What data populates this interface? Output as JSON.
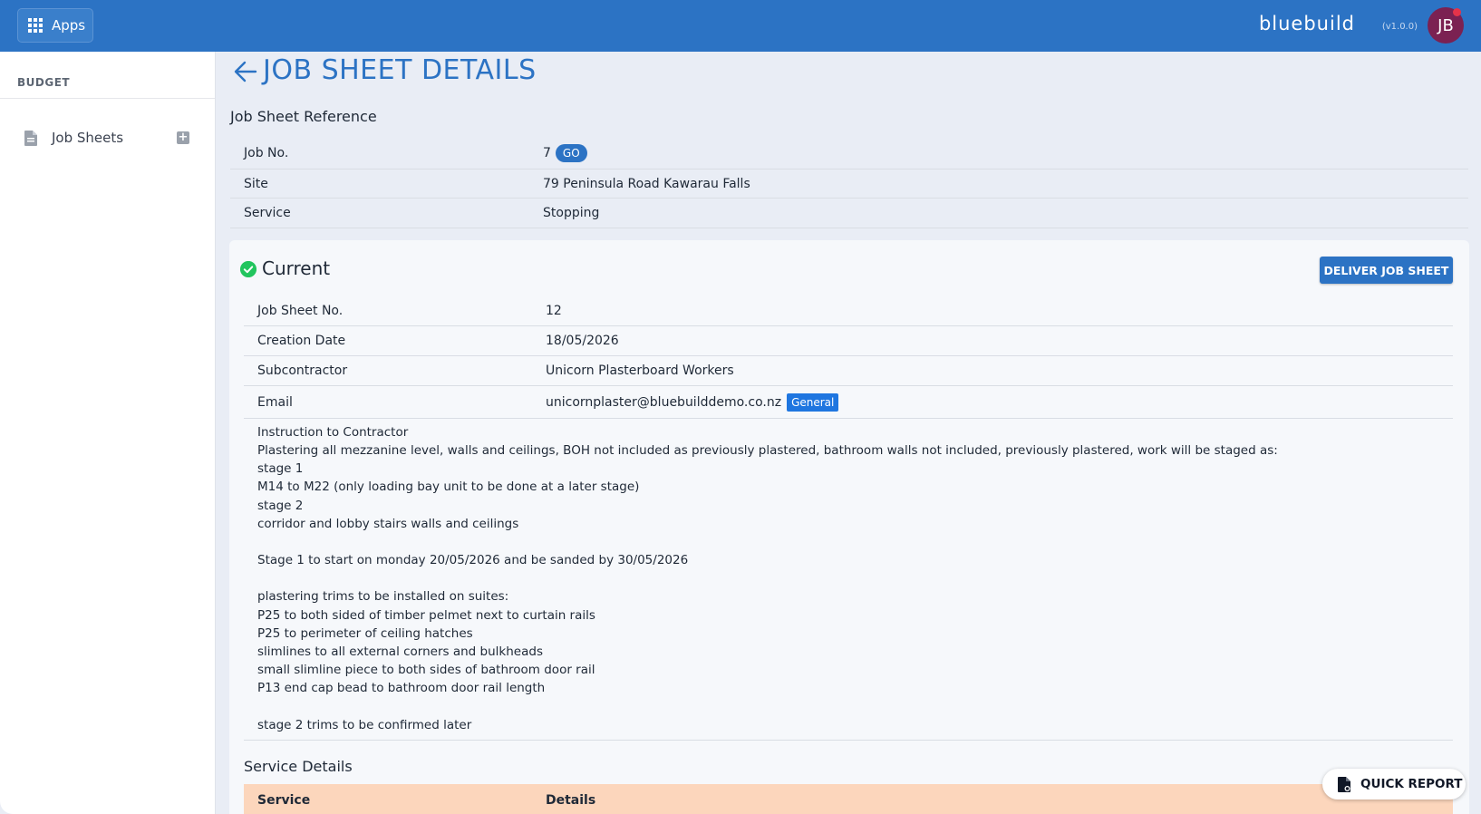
{
  "topbar": {
    "apps_label": "Apps",
    "brand": "bluebuild",
    "version": "(v1.0.0)",
    "avatar_initials": "JB"
  },
  "sidebar": {
    "heading": "BUDGET",
    "items": [
      {
        "label": "Job Sheets",
        "icon": "document-icon",
        "action_icon": "add-icon"
      }
    ]
  },
  "page": {
    "title": "JOB SHEET DETAILS"
  },
  "reference": {
    "title": "Job Sheet Reference",
    "rows": [
      {
        "label": "Job No.",
        "value": "7",
        "button": "GO"
      },
      {
        "label": "Site",
        "value": "79 Peninsula Road Kawarau Falls"
      },
      {
        "label": "Service",
        "value": "Stopping"
      }
    ]
  },
  "current": {
    "status": "Current",
    "deliver_button": "DELIVER JOB SHEET",
    "rows": [
      {
        "label": "Job Sheet No.",
        "value": "12"
      },
      {
        "label": "Creation Date",
        "value": "18/05/2026"
      },
      {
        "label": "Subcontractor",
        "value": "Unicorn Plasterboard Workers"
      },
      {
        "label": "Email",
        "value": "unicornplaster@bluebuilddemo.co.nz",
        "badge": "General"
      }
    ],
    "instructions": "Instruction to Contractor\nPlastering all mezzanine level, walls and ceilings, BOH not included as previously plastered, bathroom walls not included, previously plastered, work will be staged as:\nstage 1\nM14 to M22 (only loading bay unit to be done at a later stage)\nstage 2\ncorridor and lobby stairs walls and ceilings\n\nStage 1 to start on monday 20/05/2026 and be sanded by 30/05/2026\n\nplastering trims to be installed on suites:\nP25 to both sided of timber pelmet next to curtain rails\nP25 to perimeter of ceiling hatches\nslimlines to all external corners and bulkheads\nsmall slimline piece to both sides of bathroom door rail\nP13 end cap bead to bathroom door rail length\n\nstage 2 trims to be confirmed later"
  },
  "service_details": {
    "title": "Service Details",
    "columns": [
      "Service",
      "Details"
    ]
  },
  "quick_report": {
    "label": "QUICK REPORT"
  },
  "colors": {
    "primary": "#2c73c4",
    "success": "#22c55e",
    "table_header": "#fcd6bc",
    "badge": "#1f76e0",
    "avatar": "#7b2152"
  }
}
